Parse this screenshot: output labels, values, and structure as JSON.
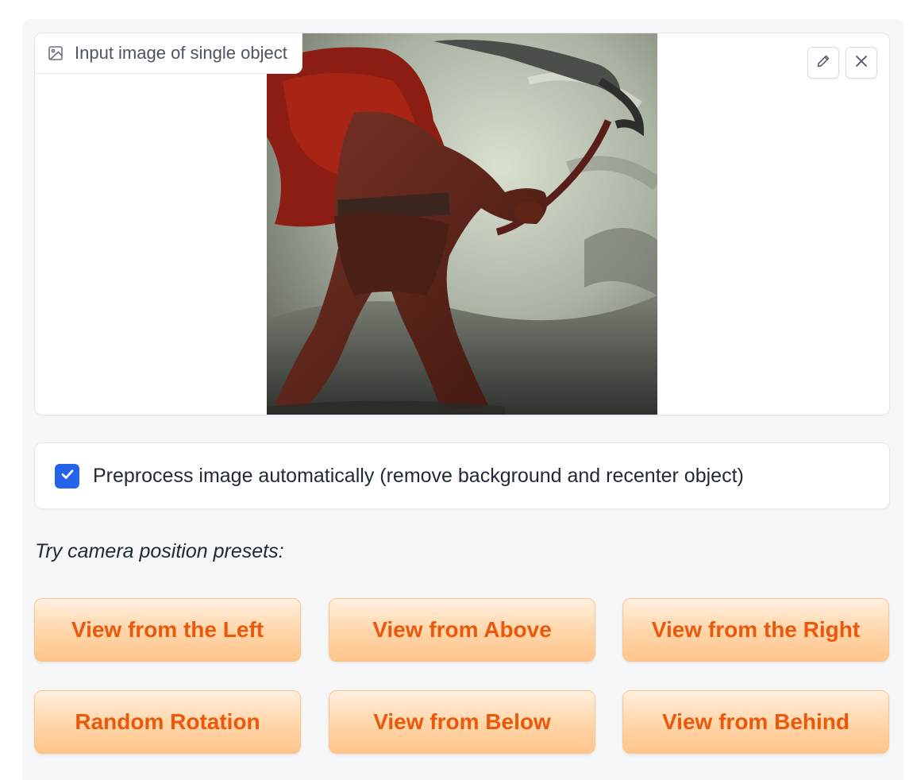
{
  "image_input": {
    "label": "Input image of single object",
    "image_icon": "image-icon",
    "edit_icon": "pencil-icon",
    "clear_icon": "close-icon"
  },
  "preprocess": {
    "checked": true,
    "label": "Preprocess image automatically (remove background and recenter object)"
  },
  "presets": {
    "heading": "Try camera position presets:",
    "buttons": [
      {
        "label": "View from the Left"
      },
      {
        "label": "View from Above"
      },
      {
        "label": "View from the Right"
      },
      {
        "label": "Random Rotation"
      },
      {
        "label": "View from Below"
      },
      {
        "label": "View from Behind"
      }
    ]
  },
  "colors": {
    "accent": "#ea580c",
    "button_gradient_top": "#fff0e0",
    "button_gradient_bottom": "#ffc48a",
    "checkbox": "#2563eb",
    "panel_bg": "#f6f7f9"
  }
}
